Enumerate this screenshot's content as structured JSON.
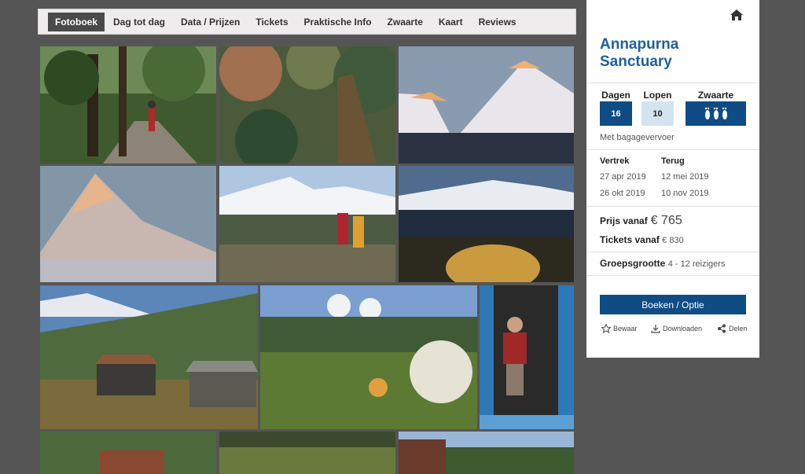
{
  "tabs": [
    {
      "label": "Fotoboek",
      "active": true
    },
    {
      "label": "Dag tot dag"
    },
    {
      "label": "Data / Prijzen"
    },
    {
      "label": "Tickets"
    },
    {
      "label": "Praktische Info"
    },
    {
      "label": "Zwaarte"
    },
    {
      "label": "Kaart"
    },
    {
      "label": "Reviews"
    }
  ],
  "panel": {
    "home_icon": "home-icon",
    "title_line1": "Annapurna",
    "title_line2": "Sanctuary",
    "stats": {
      "dagen_label": "Dagen",
      "dagen_value": "16",
      "lopen_label": "Lopen",
      "lopen_value": "10",
      "zwaarte_label": "Zwaarte",
      "zwaarte_icon": "footprints-icon"
    },
    "baggage": "Met bagagevervoer",
    "dates": {
      "vertrek_label": "Vertrek",
      "terug_label": "Terug",
      "rows": [
        {
          "vertrek": "27 apr 2019",
          "terug": "12 mei 2019"
        },
        {
          "vertrek": "26 okt 2019",
          "terug": "10 nov 2019"
        }
      ]
    },
    "price_label": "Prijs vanaf",
    "price_value": "€ 765",
    "tickets_label": "Tickets vanaf",
    "tickets_value": "€ 830",
    "group_label": "Groepsgrootte",
    "group_value": "4 - 12 reizigers",
    "book_button": "Boeken / Optie",
    "actions": {
      "save": "Bewaar",
      "download": "Downloaden",
      "share": "Delen"
    }
  },
  "colors": {
    "brand_blue": "#0f4c85",
    "title_blue": "#1f5f9d",
    "light_blue": "#d4e3f0",
    "background": "#555555"
  }
}
